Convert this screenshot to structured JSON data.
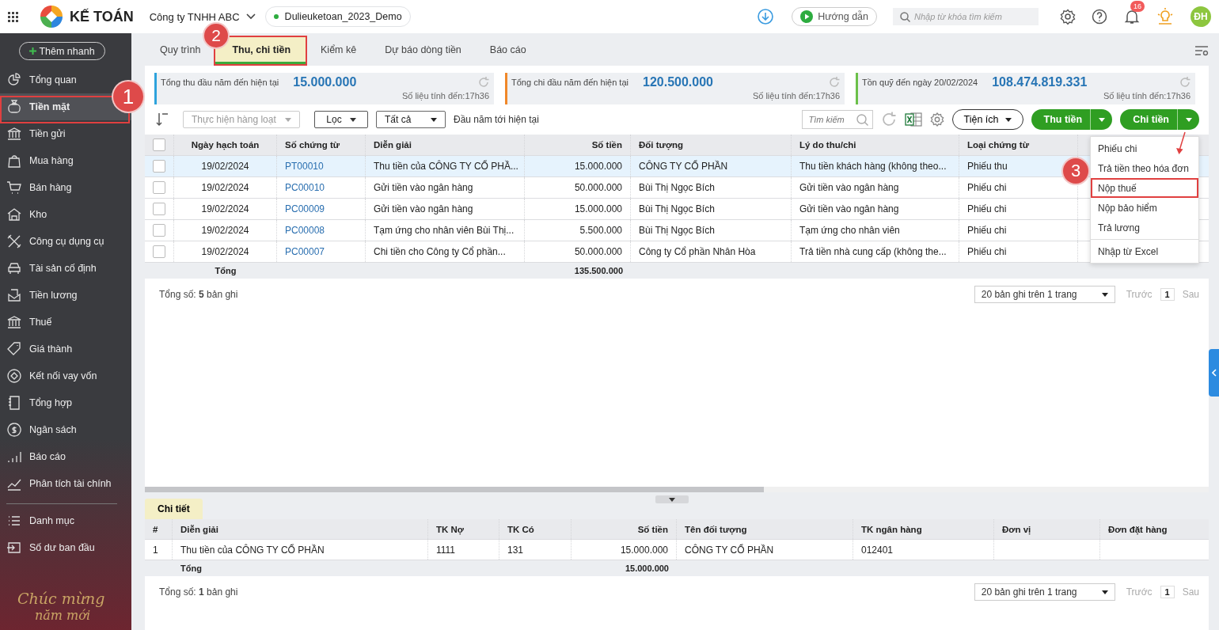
{
  "topbar": {
    "app_name": "KẾ TOÁN",
    "company": "Công ty TNHH ABC",
    "database": "Dulieuketoan_2023_Demo",
    "guide": "Hướng dẫn",
    "search": {
      "placeholder": "Nhập từ khóa tìm kiếm"
    },
    "notifications": "16",
    "avatar": "ĐH"
  },
  "sidebar": {
    "quick_add": "Thêm nhanh",
    "items": [
      {
        "label": "Tổng quan",
        "selected": false
      },
      {
        "label": "Tiền mặt",
        "selected": true
      },
      {
        "label": "Tiền gửi",
        "selected": false
      },
      {
        "label": "Mua hàng",
        "selected": false
      },
      {
        "label": "Bán hàng",
        "selected": false
      },
      {
        "label": "Kho",
        "selected": false
      },
      {
        "label": "Công cụ dụng cụ",
        "selected": false
      },
      {
        "label": "Tài sản cố định",
        "selected": false
      },
      {
        "label": "Tiền lương",
        "selected": false
      },
      {
        "label": "Thuế",
        "selected": false
      },
      {
        "label": "Giá thành",
        "selected": false
      },
      {
        "label": "Kết nối vay vốn",
        "selected": false
      },
      {
        "label": "Tổng hợp",
        "selected": false
      },
      {
        "label": "Ngân sách",
        "selected": false
      },
      {
        "label": "Báo cáo",
        "selected": false
      },
      {
        "label": "Phân tích tài chính",
        "selected": false
      }
    ],
    "secondary_items": [
      {
        "label": "Danh mục",
        "selected": false
      },
      {
        "label": "Số dư ban đầu",
        "selected": false
      }
    ],
    "greeting": [
      "Chúc mừng",
      "năm mới"
    ]
  },
  "tabs": [
    {
      "label": "Quy trình",
      "selected": false
    },
    {
      "label": "Thu, chi tiền",
      "selected": true
    },
    {
      "label": "Kiểm kê",
      "selected": false
    },
    {
      "label": "Dự báo dòng tiền",
      "selected": false
    },
    {
      "label": "Báo cáo",
      "selected": false
    }
  ],
  "summary": [
    {
      "label": "Tổng thu đầu năm đến hiện tại",
      "value": "15.000.000",
      "note": "Số liệu tính đến:17h36",
      "color": "#2ea3dc"
    },
    {
      "label": "Tổng chi đầu năm đến hiện tại",
      "value": "120.500.000",
      "note": "Số liệu tính đến:17h36",
      "color": "#f0882a"
    },
    {
      "label": "Tồn quỹ đến ngày 20/02/2024",
      "value": "108.474.819.331",
      "note": "Số liệu tính đến:17h36",
      "color": "#6cc04a"
    }
  ],
  "toolbar": {
    "bulk_action": {
      "label": "Thực hiện hàng loạt",
      "disabled": true
    },
    "filter": "Lọc",
    "scope": "Tất cả",
    "period": "Đầu năm tới hiện tại",
    "search": {
      "placeholder": "Tìm kiếm"
    },
    "utilities": "Tiện ích",
    "receive": "Thu tiền",
    "pay": "Chi tiền"
  },
  "pay_menu": [
    {
      "label": "Phiếu chi",
      "divider_before": false,
      "highlighted": false
    },
    {
      "label": "Trả tiền theo hóa đơn",
      "divider_before": false,
      "highlighted": false
    },
    {
      "label": "Nộp thuế",
      "divider_before": false,
      "highlighted": true
    },
    {
      "label": "Nộp bảo hiểm",
      "divider_before": false,
      "highlighted": false
    },
    {
      "label": "Trả lương",
      "divider_before": false,
      "highlighted": false
    },
    {
      "label": "Nhập từ Excel",
      "divider_before": true,
      "highlighted": false
    }
  ],
  "table": {
    "all_checked": false,
    "columns": [
      "Ngày hạch toán",
      "Số chứng từ",
      "Diễn giải",
      "Số tiền",
      "Đối tượng",
      "Lý do thu/chi",
      "Loại chứng từ"
    ],
    "rows": [
      {
        "selected": true,
        "checked": false,
        "cells": [
          "19/02/2024",
          "PT00010",
          "Thu tiền của CÔNG TY CỔ PHẦ...",
          "15.000.000",
          "CÔNG TY CỔ PHẦN",
          "Thu tiền khách hàng (không theo...",
          "Phiếu thu"
        ]
      },
      {
        "selected": false,
        "checked": false,
        "cells": [
          "19/02/2024",
          "PC00010",
          "Gửi tiền vào ngân hàng",
          "50.000.000",
          "Bùi Thị Ngọc Bích",
          "Gửi tiền vào ngân hàng",
          "Phiếu chi"
        ]
      },
      {
        "selected": false,
        "checked": false,
        "cells": [
          "19/02/2024",
          "PC00009",
          "Gửi tiền vào ngân hàng",
          "15.000.000",
          "Bùi Thị Ngọc Bích",
          "Gửi tiền vào ngân hàng",
          "Phiếu chi"
        ]
      },
      {
        "selected": false,
        "checked": false,
        "cells": [
          "19/02/2024",
          "PC00008",
          "Tạm ứng cho nhân viên Bùi Thị...",
          "5.500.000",
          "Bùi Thị Ngọc Bích",
          "Tạm ứng cho nhân viên",
          "Phiếu chi"
        ]
      },
      {
        "selected": false,
        "checked": false,
        "cells": [
          "19/02/2024",
          "PC00007",
          "Chi tiền cho Công ty Cổ phần...",
          "50.000.000",
          "Công ty Cổ phần Nhân Hòa",
          "Trả tiền nhà cung cấp (không the...",
          "Phiếu chi"
        ]
      }
    ],
    "total_label": "Tổng",
    "total": "135.500.000",
    "count": "Tổng số: **5** bản ghi"
  },
  "pagination": {
    "page_size": "20 bản ghi trên 1 trang",
    "prev": "Trước",
    "page": "1",
    "next": "Sau"
  },
  "detail": {
    "tab": "Chi tiết",
    "columns": [
      "#",
      "Diễn giải",
      "TK Nợ",
      "TK Có",
      "Số tiền",
      "Tên đối tượng",
      "TK ngân hàng",
      "Đơn vị",
      "Đơn đặt hàng"
    ],
    "rows": [
      [
        "1",
        "Thu tiền của CÔNG TY CỔ PHẦN",
        "1111",
        "131",
        "15.000.000",
        "CÔNG TY CỔ PHẦN",
        "012401",
        "",
        ""
      ]
    ],
    "total_label": "Tổng",
    "total": "15.000.000",
    "count": "Tổng số: **1** bản ghi",
    "pagination": {
      "page_size": "20 bản ghi trên 1 trang",
      "prev": "Trước",
      "page": "1",
      "next": "Sau"
    }
  },
  "annotations": [
    {
      "kind": "frame"
    },
    {
      "kind": "frame"
    },
    {
      "kind": "arrow"
    },
    {
      "kind": "badge",
      "label": "1"
    },
    {
      "kind": "badge",
      "label": "2"
    },
    {
      "kind": "badge",
      "label": "3"
    }
  ]
}
